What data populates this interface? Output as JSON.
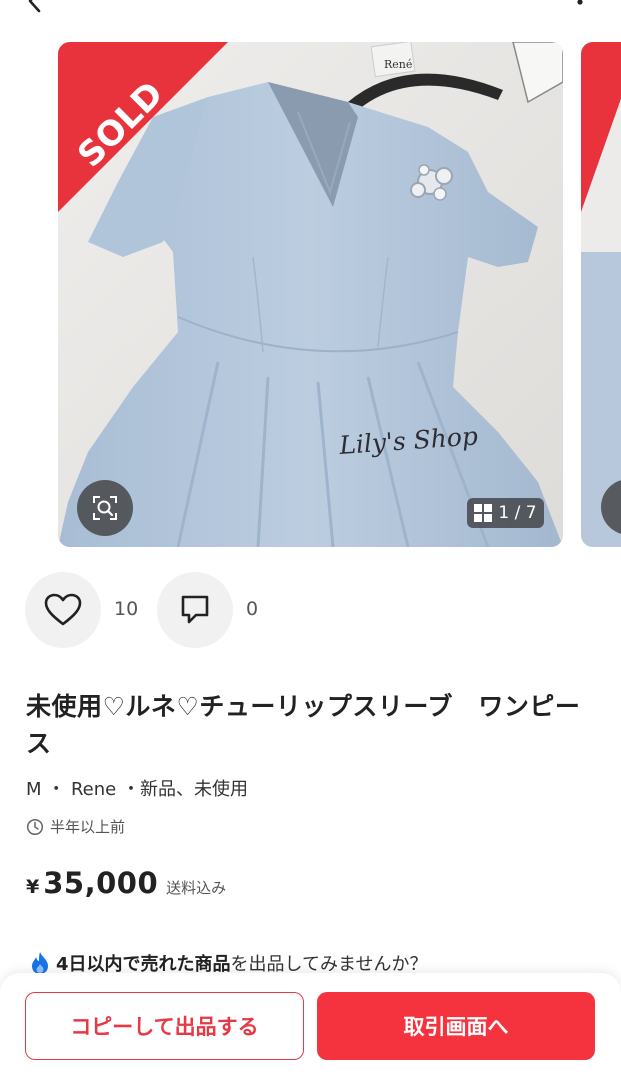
{
  "topbar": {
    "back_icon": "chevron-left-icon",
    "more_icon": "more-vertical-icon"
  },
  "gallery": {
    "sold_label": "SOLD",
    "watermark": "Lily's Shop",
    "tag_text": "René",
    "counter": "1 / 7",
    "zoom_icon": "zoom-search-icon",
    "grid_icon": "grid-icon"
  },
  "reactions": {
    "likes": "10",
    "comments": "0"
  },
  "item": {
    "title": "未使用♡ルネ♡チューリップスリーブ　ワンピース",
    "meta": "M ・ Rene ・新品、未使用",
    "posted": "半年以上前",
    "yen": "¥",
    "price": "35,000",
    "shipping": "送料込み"
  },
  "promo": {
    "bold": "4日以内で売れた商品",
    "rest": "を出品してみませんか？"
  },
  "actions": {
    "copy_label": "コピーして出品する",
    "trade_label": "取引画面へ"
  },
  "colors": {
    "accent": "#f5333f",
    "sold_banner": "#e8323c",
    "dress": "#b4c7dc"
  }
}
